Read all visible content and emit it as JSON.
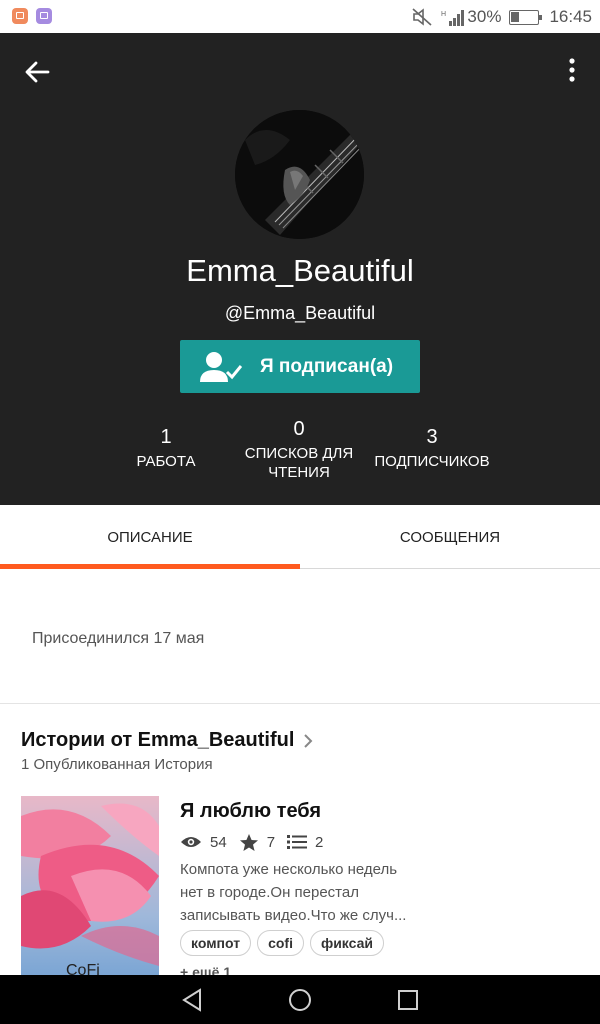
{
  "status_bar": {
    "battery_percent": "30%",
    "battery_level": 0.3,
    "time": "16:45",
    "icons": [
      "notification-app-icon",
      "notification-app-icon",
      "mute-icon",
      "signal-icon",
      "battery-icon"
    ]
  },
  "header": {
    "back_icon": "arrow-left-icon",
    "menu_icon": "more-vertical-icon",
    "username": "Emma_Beautiful",
    "handle": "@Emma_Beautiful",
    "follow_button": {
      "label": "Я подписан(а)",
      "icon": "user-check-icon"
    },
    "stats": [
      {
        "value": "1",
        "label": "РАБОТА"
      },
      {
        "value": "0",
        "label_lines": [
          "СПИСКОВ ДЛЯ",
          "ЧТЕНИЯ"
        ]
      },
      {
        "value": "3",
        "label": "ПОДПИСЧИКОВ"
      }
    ]
  },
  "tabs": [
    {
      "label": "ОПИСАНИЕ",
      "active": true
    },
    {
      "label": "СООБЩЕНИЯ",
      "active": false
    }
  ],
  "about": {
    "joined": "Присоединился 17 мая"
  },
  "stories_section": {
    "title": "Истории от Emma_Beautiful",
    "subtitle": "1 Опубликованная История",
    "story": {
      "cover_text": "CoFi",
      "title": "Я люблю тебя",
      "reads": "54",
      "votes": "7",
      "parts": "2",
      "description_lines": [
        "Компота уже несколько недель",
        "нет в городе.Он перестал",
        "записывать видео.Что же случ..."
      ],
      "tags": [
        "компот",
        "cofi",
        "фиксай"
      ],
      "more_tags": "+ ещё 1"
    }
  },
  "colors": {
    "header_bg": "#222222",
    "follow_button": "#1a9a96",
    "tab_indicator": "#ff5a1f",
    "nav_bar": "#000000"
  },
  "nav_bar": {
    "icons": [
      "back-triangle-icon",
      "home-circle-icon",
      "recents-square-icon"
    ]
  }
}
